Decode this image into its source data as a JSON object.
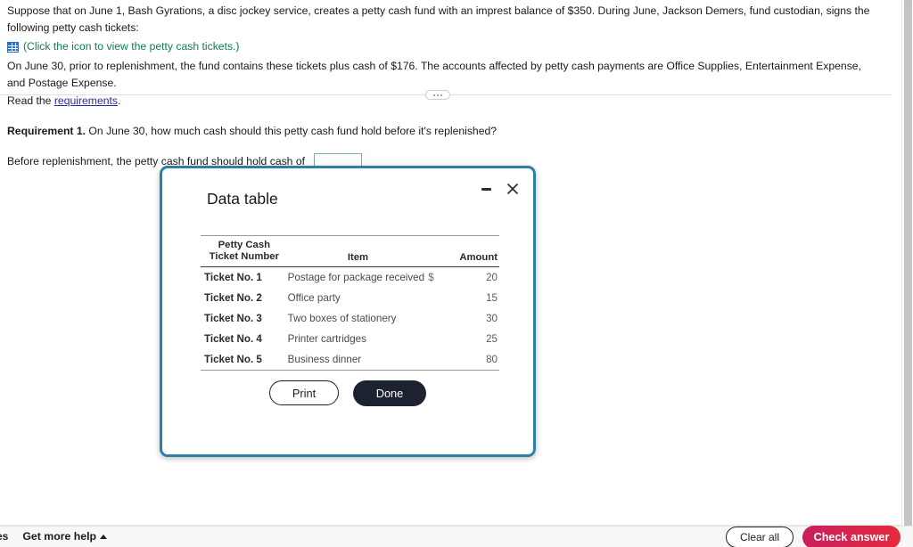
{
  "problem": {
    "paragraph1": "Suppose that on June 1, Bash Gyrations, a disc jockey service, creates a petty cash fund with an imprest balance of $350. During June, Jackson Demers, fund custodian, signs the following petty cash tickets:",
    "icon_link_text": "(Click the icon to view the petty cash tickets.)",
    "paragraph2": "On June 30, prior to replenishment, the fund contains these tickets plus cash of $176. The accounts affected by petty cash payments are Office Supplies, Entertainment Expense, and Postage Expense.",
    "read_prefix": "Read the ",
    "read_link": "requirements",
    "read_suffix": "."
  },
  "requirement": {
    "label": "Requirement 1.",
    "question": " On June 30, how much cash should this petty cash fund hold before it's replenished?",
    "answer_label": "Before replenishment, the petty cash fund should hold cash of",
    "answer_value": "",
    "answer_placeholder": ""
  },
  "modal": {
    "title": "Data table",
    "minimize_label": "Minimize",
    "close_label": "Close",
    "print_label": "Print",
    "done_label": "Done",
    "table": {
      "headers": {
        "ticket_line1": "Petty Cash",
        "ticket_line2": "Ticket Number",
        "item": "Item",
        "amount": "Amount"
      },
      "rows": [
        {
          "ticket": "Ticket No. 1",
          "item": "Postage for package received",
          "currency": "$",
          "amount": "20"
        },
        {
          "ticket": "Ticket No. 2",
          "item": "Office party",
          "currency": "",
          "amount": "15"
        },
        {
          "ticket": "Ticket No. 3",
          "item": "Two boxes of stationery",
          "currency": "",
          "amount": "30"
        },
        {
          "ticket": "Ticket No. 4",
          "item": "Printer cartridges",
          "currency": "",
          "amount": "25"
        },
        {
          "ticket": "Ticket No. 5",
          "item": "Business dinner",
          "currency": "",
          "amount": "80"
        }
      ]
    }
  },
  "bottom_bar": {
    "partial_left_label": "es",
    "help_label": "Get more help",
    "clear_label": "Clear all",
    "check_label": "Check answer"
  },
  "colors": {
    "modal_border": "#2b7fa8",
    "link": "#2a2aa8",
    "icon_link": "#0e7c5a",
    "grid_icon": "#2f6fc4",
    "done_button": "#1d2230",
    "check_answer_start": "#c91f5e",
    "check_answer_end": "#e52a3c"
  }
}
